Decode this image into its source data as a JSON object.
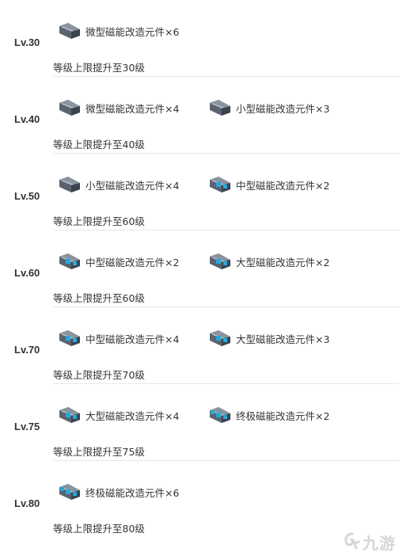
{
  "rows": [
    {
      "level": "Lv.30",
      "items": [
        {
          "icon": "micro-magnet-part-icon",
          "label": "微型磁能改造元件×6"
        }
      ],
      "desc": "等级上限提升至30级"
    },
    {
      "level": "Lv.40",
      "items": [
        {
          "icon": "micro-magnet-part-icon",
          "label": "微型磁能改造元件×4"
        },
        {
          "icon": "small-magnet-part-icon",
          "label": "小型磁能改造元件×3"
        }
      ],
      "desc": "等级上限提升至40级"
    },
    {
      "level": "Lv.50",
      "items": [
        {
          "icon": "small-magnet-part-icon",
          "label": "小型磁能改造元件×4"
        },
        {
          "icon": "medium-magnet-part-icon",
          "label": "中型磁能改造元件×2"
        }
      ],
      "desc": "等级上限提升至60级"
    },
    {
      "level": "Lv.60",
      "items": [
        {
          "icon": "medium-magnet-part-icon",
          "label": "中型磁能改造元件×2"
        },
        {
          "icon": "large-magnet-part-icon",
          "label": "大型磁能改造元件×2"
        }
      ],
      "desc": "等级上限提升至60级"
    },
    {
      "level": "Lv.70",
      "items": [
        {
          "icon": "medium-magnet-part-icon",
          "label": "中型磁能改造元件×4"
        },
        {
          "icon": "large-magnet-part-icon",
          "label": "大型磁能改造元件×3"
        }
      ],
      "desc": "等级上限提升至70级"
    },
    {
      "level": "Lv.75",
      "items": [
        {
          "icon": "large-magnet-part-icon",
          "label": "大型磁能改造元件×4"
        },
        {
          "icon": "ultimate-magnet-part-icon",
          "label": "终极磁能改造元件×2"
        }
      ],
      "desc": "等级上限提升至75级"
    },
    {
      "level": "Lv.80",
      "items": [
        {
          "icon": "ultimate-magnet-part-icon",
          "label": "终极磁能改造元件×6"
        }
      ],
      "desc": "等级上限提升至80级"
    }
  ],
  "watermark": {
    "text": "九游",
    "icon": "jiuyou-logo-icon"
  },
  "colors": {
    "text": "#333333",
    "divider": "#e6e6e6",
    "icon_dark": "#3a4450",
    "icon_accent": "#2aa8d8"
  }
}
